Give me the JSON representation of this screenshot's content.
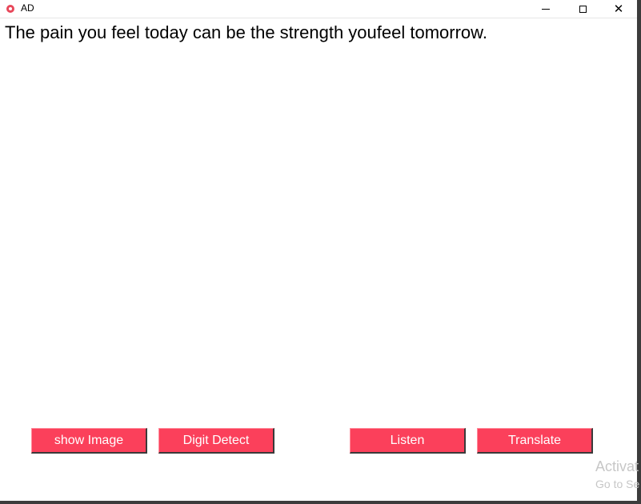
{
  "window": {
    "title": "AD",
    "controls": {
      "minimize": "minimize-icon",
      "maximize": "maximize-icon",
      "close": "close-icon"
    }
  },
  "main": {
    "quote": "The pain you feel today can be the strength youfeel tomorrow."
  },
  "buttons": {
    "show_image": "show Image",
    "digit_detect": "Digit Detect",
    "listen": "Listen",
    "translate": "Translate"
  },
  "colors": {
    "button_bg": "#fb405b",
    "button_text": "#ffffff"
  },
  "watermark": {
    "line1": "Activat",
    "line2": "Go to Se"
  }
}
